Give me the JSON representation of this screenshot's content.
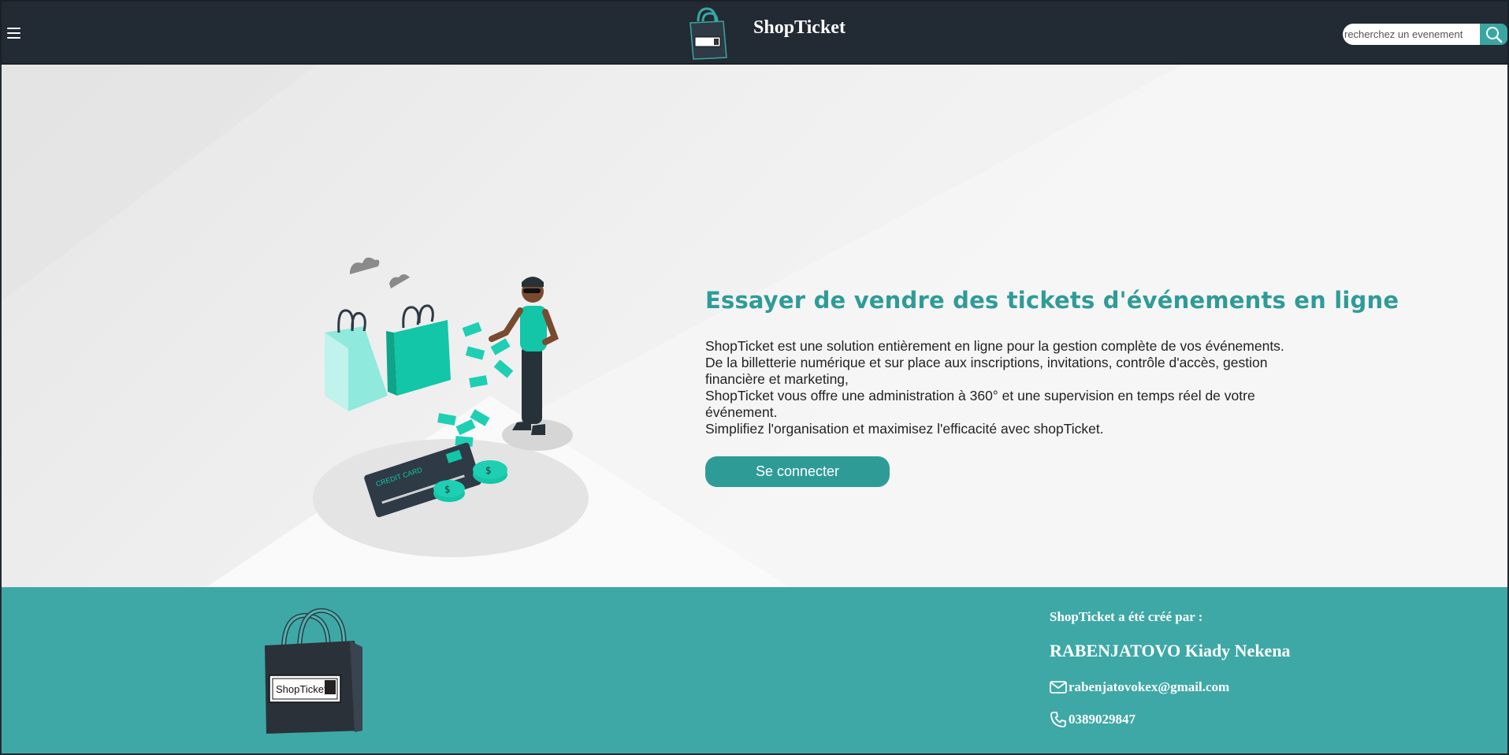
{
  "header": {
    "brand": "ShopTicket",
    "menu_icon": "hamburger-menu-icon",
    "search": {
      "placeholder": "recherchez un evenement",
      "value": "",
      "icon": "search-icon"
    }
  },
  "hero": {
    "title": "Essayer de vendre des tickets d'événements en ligne",
    "paragraphs": [
      "ShopTicket est une solution entièrement en ligne pour la gestion complète de vos événements.",
      "De la billetterie numérique et sur place aux inscriptions, invitations, contrôle d'accès, gestion financière et marketing,",
      "ShopTicket vous offre une administration à 360° et une supervision en temps réel de votre événement.",
      "Simplifiez l'organisation et maximisez l'efficacité avec shopTicket."
    ],
    "cta_label": "Se connecter",
    "illustration_text": "CREDIT CARD"
  },
  "footer": {
    "logo_text": "ShopTicket",
    "creator_heading": "ShopTicket a été créé par :",
    "creator_name": "RABENJATOVO Kiady Nekena",
    "email": "rabenjatovokex@gmail.com",
    "phone": "0389029847",
    "email_icon": "mail-icon",
    "phone_icon": "phone-icon"
  },
  "colors": {
    "header_bg": "#222a33",
    "accent": "#2f9b97",
    "footer_bg": "#3ea8a6",
    "illustration_teal": "#1fcfb3"
  }
}
